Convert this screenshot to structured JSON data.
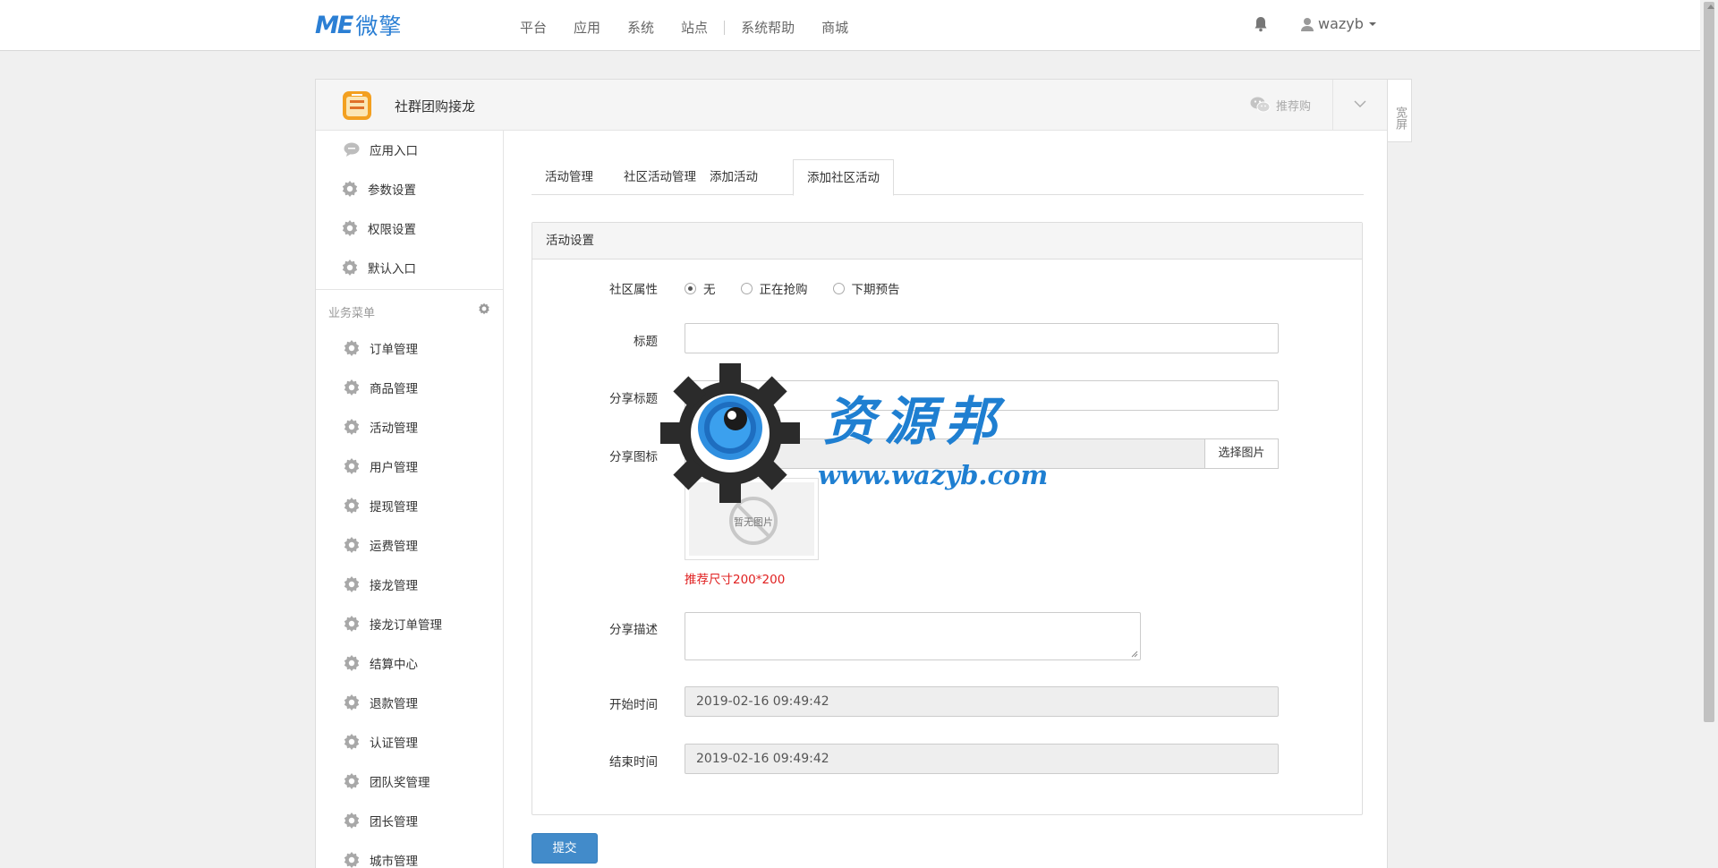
{
  "topbar": {
    "brand_mark": "ME",
    "brand_name": "微擎",
    "nav": [
      "平台",
      "应用",
      "系统",
      "站点",
      "系统帮助",
      "商城"
    ],
    "username": "wazyb"
  },
  "app": {
    "title": "社群团购接龙",
    "wechat_label": "推荐购",
    "wide_label": "宽屏"
  },
  "sidebar": {
    "top_items": [
      "应用入口",
      "参数设置",
      "权限设置",
      "默认入口"
    ],
    "section_title": "业务菜单",
    "menu_items": [
      "订单管理",
      "商品管理",
      "活动管理",
      "用户管理",
      "提现管理",
      "运费管理",
      "接龙管理",
      "接龙订单管理",
      "结算中心",
      "退款管理",
      "认证管理",
      "团队奖管理",
      "团长管理",
      "城市管理"
    ]
  },
  "tabs": [
    "活动管理",
    "社区活动管理",
    "添加活动",
    "添加社区活动"
  ],
  "active_tab": "添加社区活动",
  "form": {
    "section_title": "活动设置",
    "community_label": "社区属性",
    "community_options": [
      "无",
      "正在抢购",
      "下期预告"
    ],
    "community_selected": "无",
    "title_label": "标题",
    "title_value": "",
    "share_title_label": "分享标题",
    "share_title_value": "",
    "share_icon_label": "分享图标",
    "choose_image": "选择图片",
    "no_image": "暂无图片",
    "size_hint": "推荐尺寸200*200",
    "share_desc_label": "分享描述",
    "start_label": "开始时间",
    "start_value": "2019-02-16 09:49:42",
    "end_label": "结束时间",
    "end_value": "2019-02-16 09:49:42",
    "submit": "提交"
  },
  "watermark": {
    "title": "资源邦",
    "url": "www.wazyb.com"
  },
  "colors": {
    "brand": "#2b7fd4",
    "primary_button": "#428bca",
    "hint": "#e02020"
  }
}
